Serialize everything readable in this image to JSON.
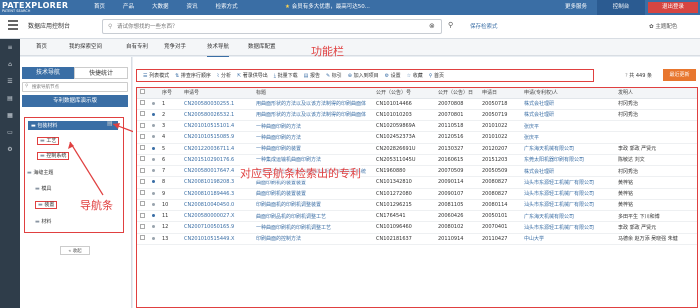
{
  "topbar": {
    "logo": "PATEXPLORER",
    "logo_sub": "PATENT SEARCH",
    "nav": [
      "首页",
      "产品",
      "大数据",
      "资讯",
      "检索方式"
    ],
    "message": "会员有多大优惠，最高可达50...",
    "more": "更多服务",
    "control": "控制台",
    "logout": "退出登录"
  },
  "subbar": {
    "title": "数据应用控制台",
    "search_placeholder": "请试你想找的一些东西？",
    "save_search": "保存检索式",
    "theme": "主题配色"
  },
  "leftbar_icons": [
    "menu-icon",
    "home-icon",
    "list-icon",
    "doc-icon",
    "chart-icon",
    "folder-icon",
    "settings-icon"
  ],
  "tabs": [
    "首页",
    "我的探索空间",
    "自有专利",
    "竞争对手",
    "技术导航",
    "数据库配置"
  ],
  "sidebar": {
    "tab_nav": "技术导航",
    "tab_quick": "快捷统计",
    "search_placeholder": "搜索导航节点",
    "demo_title": "专利数据库演示版",
    "nodes": [
      {
        "label": "包装材料",
        "selected": true
      },
      {
        "label": "工艺",
        "selected": false
      },
      {
        "label": "控制系统",
        "selected": false
      },
      {
        "label": "海缝主题",
        "selected": false
      },
      {
        "label": "模具",
        "selected": false
      },
      {
        "label": "装置",
        "selected": false
      },
      {
        "label": "材料",
        "selected": false
      }
    ],
    "collapse": "« 收起"
  },
  "annotations": {
    "function_bar": "功能栏",
    "nav_bar": "导航条",
    "overlay": "对应导航条检索出的专利"
  },
  "toolbar": {
    "items": [
      "列表模式",
      "排查序行顺序",
      "分析",
      "著录供导出",
      "批量下载",
      "报告",
      "标引",
      "加入到项目",
      "设置",
      "收藏",
      "首页"
    ],
    "count_label": "共 449 条",
    "update": "最近更新"
  },
  "table": {
    "headers": [
      "",
      "",
      "序号",
      "申请号",
      "标题",
      "公开（公告）号",
      "公开（公告）日",
      "申请日",
      "申请(专利权)人",
      "发明人"
    ],
    "rows": [
      [
        "1",
        "CN200580030255.1",
        "用曲面形状的方法以及以该方法制得的印刷曲面体",
        "CN101014466",
        "20070808",
        "20050718",
        "株式会社理研",
        "村冈秀治"
      ],
      [
        "2",
        "CN200580026532.1",
        "用曲面形状的方法以及以该方法制得的印刷曲面体",
        "CN101010203",
        "20070801",
        "20050719",
        "株式会社理研",
        "村冈秀治"
      ],
      [
        "3",
        "CN201010515101.4",
        "一种曲面印刷的方法",
        "CN102059869A",
        "20110518",
        "20101022",
        "张庆平",
        ""
      ],
      [
        "4",
        "CN201010515085.9",
        "一种曲面印刷的方法",
        "CN102452373A",
        "20120516",
        "20101022",
        "张庆平",
        ""
      ],
      [
        "5",
        "CN201220036711.4",
        "一种曲面印刷的装置",
        "CN202826691U",
        "20130327",
        "20120207",
        "广东海天机械有限公司",
        "李政 郭政 严贤元"
      ],
      [
        "6",
        "CN201510290176.6",
        "一种集成运输机曲面印刷方法",
        "CN205311045U",
        "20160615",
        "20151203",
        "东莞太阳机器印刷有限公司",
        "陈敏达 刘文"
      ],
      [
        "7",
        "CN200580017647.4",
        "利用了改善型印刷机的曲面的印刷方法和控制系统",
        "CN1960880",
        "20070509",
        "20050509",
        "株式会社理研",
        "村冈秀治"
      ],
      [
        "8",
        "CN200810198208.3",
        "曲面印刷机的装置装置",
        "CN101342810",
        "20090114",
        "20080827",
        "汕头市东源轻工机械厂有限公司",
        "黄梓铭"
      ],
      [
        "9",
        "CN200810189446.3",
        "曲面印刷机的装置装置",
        "CN101272080",
        "20090107",
        "20080827",
        "汕头市东源轻工机械厂有限公司",
        "黄梓铭"
      ],
      [
        "10",
        "CN200810040450.0",
        "印刷曲面机的印刷机调整装置",
        "CN101296215",
        "20081105",
        "20080114",
        "汕头市东源轻工机械厂有限公司",
        "黄梓铭"
      ],
      [
        "11",
        "CN200580000027.X",
        "曲面印刷品机的印刷机调整工艺",
        "CN1764541",
        "20060426",
        "20050101",
        "广东海天机械有限公司",
        "多田平生 下川和博"
      ],
      [
        "12",
        "CN200710050165.9",
        "一种曲面印刷机的印刷机调整工艺",
        "CN101096460",
        "20080102",
        "20070401",
        "汕头市东源轻工机械厂有限公司",
        "李政 郭政 严贤元"
      ],
      [
        "13",
        "CN201010515449.X",
        "印刷曲面的控制方法",
        "CN102181637",
        "20110914",
        "20110427",
        "中山大学",
        "马德余 赵万添 吴晓强 朱健"
      ]
    ]
  }
}
